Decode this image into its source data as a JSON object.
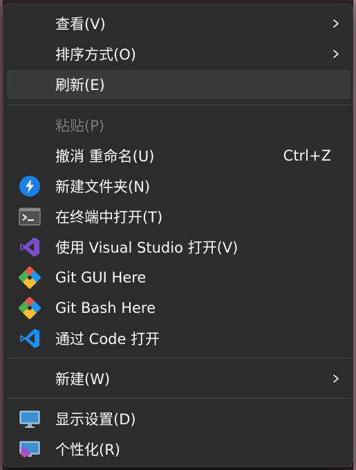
{
  "menu": {
    "view": {
      "label": "查看(V)"
    },
    "sort": {
      "label": "排序方式(O)"
    },
    "refresh": {
      "label": "刷新(E)"
    },
    "paste": {
      "label": "粘贴(P)"
    },
    "undo": {
      "label": "撤消 重命名(U)",
      "shortcut": "Ctrl+Z"
    },
    "new_folder": {
      "label": "新建文件夹(N)",
      "icon": "new-folder-icon"
    },
    "open_terminal": {
      "label": "在终端中打开(T)",
      "icon": "terminal-icon"
    },
    "open_vs": {
      "label": "使用 Visual Studio 打开(V)",
      "icon": "visual-studio-icon"
    },
    "git_gui": {
      "label": "Git GUI Here",
      "icon": "git-gui-icon"
    },
    "git_bash": {
      "label": "Git Bash Here",
      "icon": "git-bash-icon"
    },
    "open_code": {
      "label": "通过 Code 打开",
      "icon": "vscode-icon"
    },
    "new": {
      "label": "新建(W)"
    },
    "display_settings": {
      "label": "显示设置(D)",
      "icon": "display-settings-icon"
    },
    "personalize": {
      "label": "个性化(R)",
      "icon": "personalize-icon"
    }
  },
  "colors": {
    "menu_bg": "#2c2c2c",
    "hover_bg": "#3a3a3a",
    "text": "#ffffff",
    "disabled_text": "#7a7a7a",
    "separator": "#454545"
  }
}
